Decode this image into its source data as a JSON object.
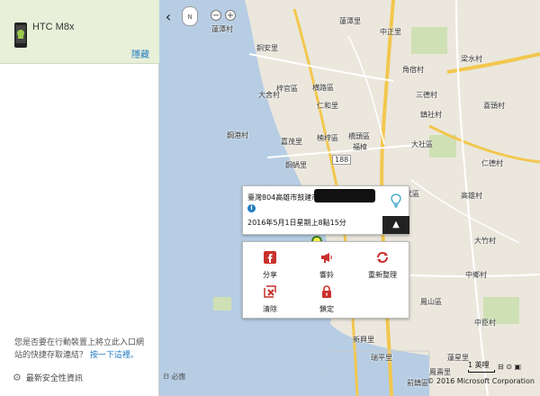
{
  "sidebar": {
    "device_name": "HTC  M8x",
    "hide_label": "隱藏",
    "notice_text": "您是否要在行動裝置上將立此入口網站的快捷存取連結？",
    "notice_link": "按一下這裡。",
    "security_label": "最新安全性資訊"
  },
  "map": {
    "labels": {
      "l1": "蓮潭村",
      "l2": "蓮潭里",
      "l3": "中正里",
      "l4": "銅安里",
      "l5": "大舍村",
      "l6": "梓官區",
      "l7": "横路區",
      "l8": "仁和里",
      "l9": "角宿村",
      "l10": "梁水村",
      "l11": "三德村",
      "l12": "鎮社村",
      "l13": "喜頭村",
      "l14": "橋頭區",
      "l15": "福樟",
      "l16": "楠梓區",
      "l17": "大社區",
      "l18": "嘉茂里",
      "l19": "鋼港村",
      "l20": "鋼蝸里",
      "l21": "仁武區",
      "l22": "仁德村",
      "l23": "高雄村",
      "l24": "大竹村",
      "l25": "中鄉村",
      "l26": "鳳山區",
      "l27": "中臣村",
      "l28": "新興里",
      "l29": "瑞平里",
      "l30": "鳳壽里",
      "l31": "前鎮區",
      "l32": "蓮星里"
    },
    "road_number": "188",
    "bing_label": "必應",
    "scale_label": "1 英哩",
    "copyright": "© 2016 Microsoft Corporation",
    "colors": {
      "sea": "#b6cde4",
      "land": "#ebe7dd",
      "road_main": "#f3c74e",
      "road_minor": "#ffffff",
      "green": "#cfe0b4"
    }
  },
  "controls": {
    "collapse_icon": "‹",
    "nav_label": "N",
    "zoom_out": "−",
    "zoom_in": "+"
  },
  "info": {
    "address": "臺灣804高雄市鼓建市",
    "time": "2016年5月1日星期上8點15分",
    "info_icon": "i"
  },
  "actions": {
    "share": "分享",
    "ring": "響鈴",
    "refresh": "重新整理",
    "erase": "清除",
    "lock": "鎖定"
  }
}
